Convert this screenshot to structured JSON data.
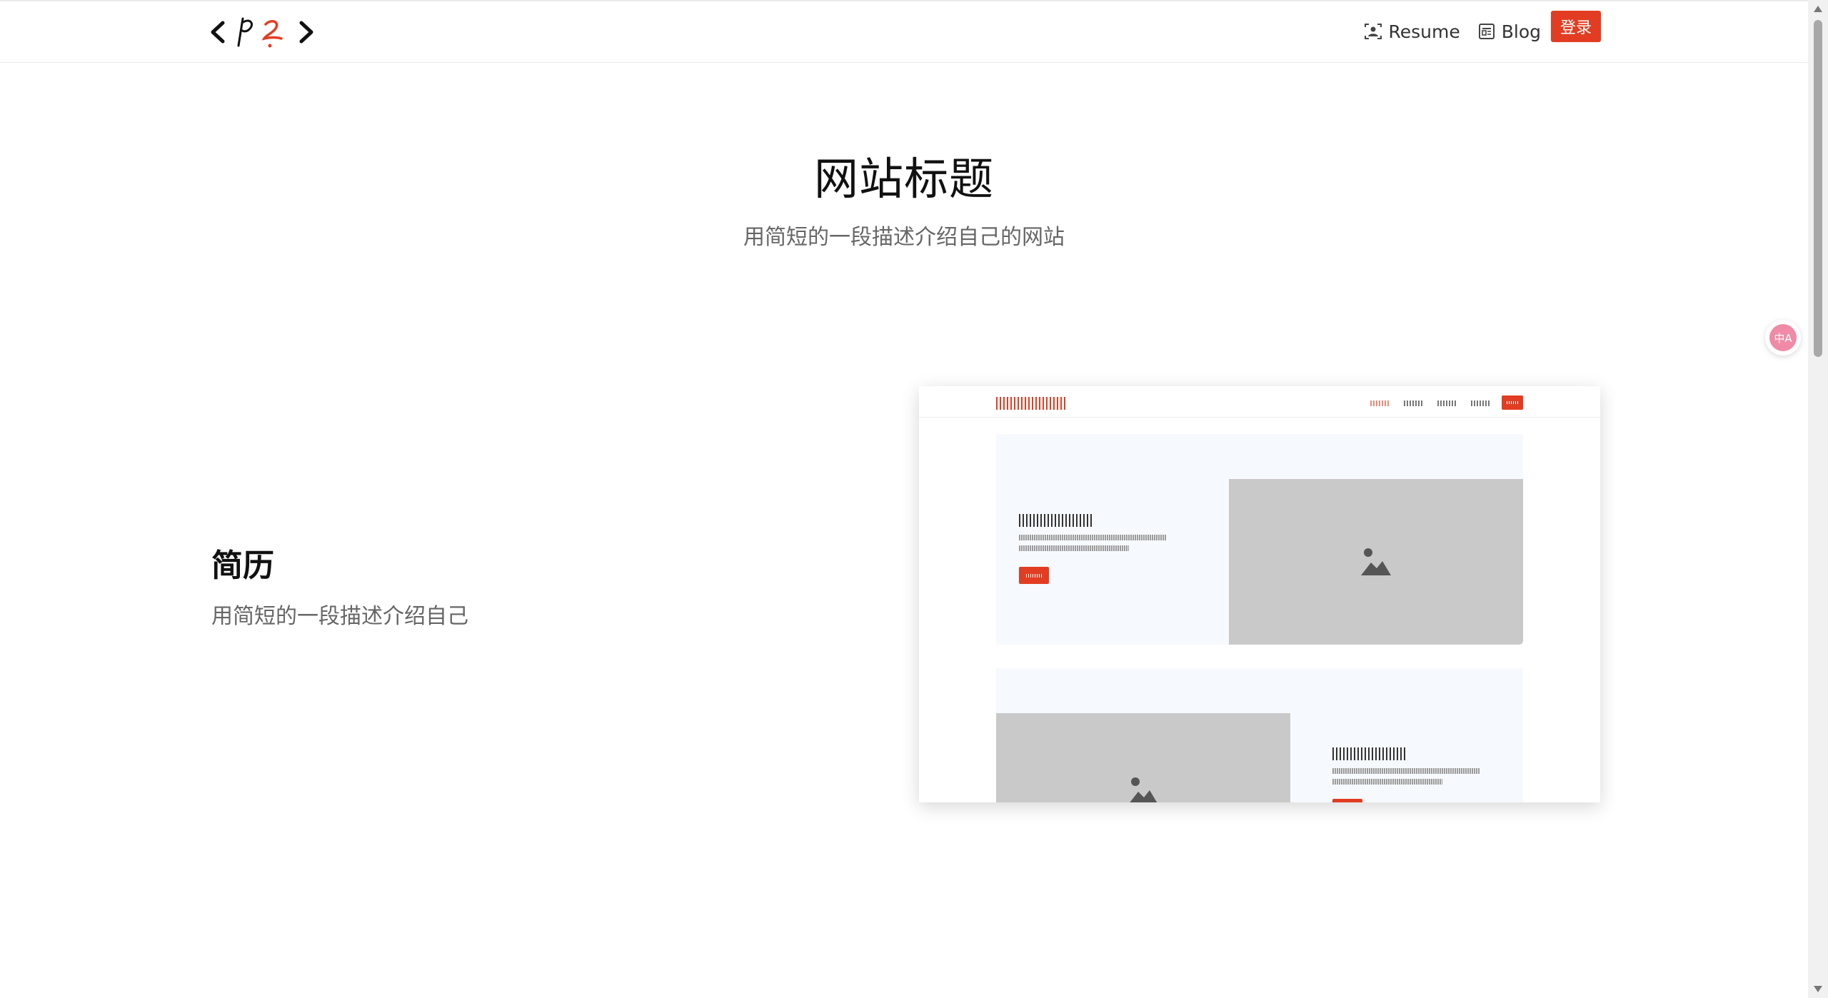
{
  "header": {
    "logo_text": "<pz>",
    "nav": [
      {
        "label": "Resume",
        "icon": "resume-icon"
      },
      {
        "label": "Blog",
        "icon": "blog-icon"
      }
    ],
    "login_label": "登录"
  },
  "hero": {
    "title": "网站标题",
    "subtitle": "用简短的一段描述介绍自己的网站"
  },
  "section": {
    "title": "简历",
    "subtitle": "用简短的一段描述介绍自己"
  },
  "translate_widget": {
    "label": "中A",
    "icon": "translate-icon"
  },
  "colors": {
    "accent": "#e23d22",
    "text": "#222222",
    "muted": "#666666",
    "placeholder": "#c9c9c9",
    "block_bg": "#f6f9fd"
  }
}
